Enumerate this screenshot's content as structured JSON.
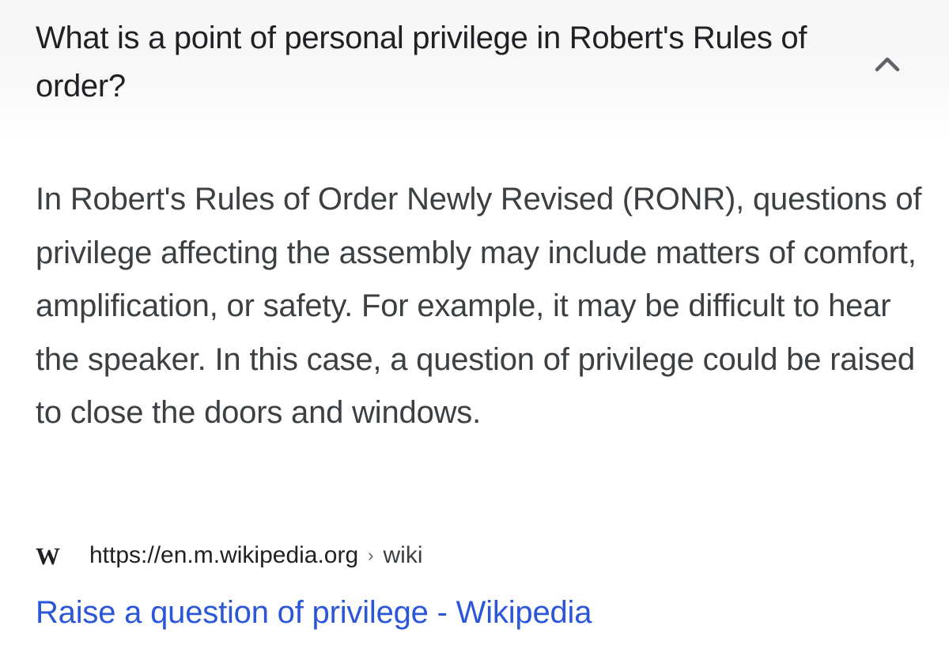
{
  "faq": {
    "question": "What is a point of personal privilege in Robert's Rules of order?",
    "expanded": true,
    "toggle_icon": "chevron-up-icon",
    "answer": "In Robert's Rules of Order Newly Revised (RONR), questions of privilege affecting the assembly may include matters of comfort, amplification, or safety. For example, it may be difficult to hear the speaker. In this case, a question of privilege could be raised to close the doors and windows."
  },
  "source": {
    "icon": "wikipedia-w-icon",
    "icon_glyph": "W",
    "url": "https://en.m.wikipedia.org",
    "separator": "›",
    "path": "wiki"
  },
  "result": {
    "title": "Raise a question of privilege - Wikipedia",
    "link_color": "#2b56d8"
  }
}
